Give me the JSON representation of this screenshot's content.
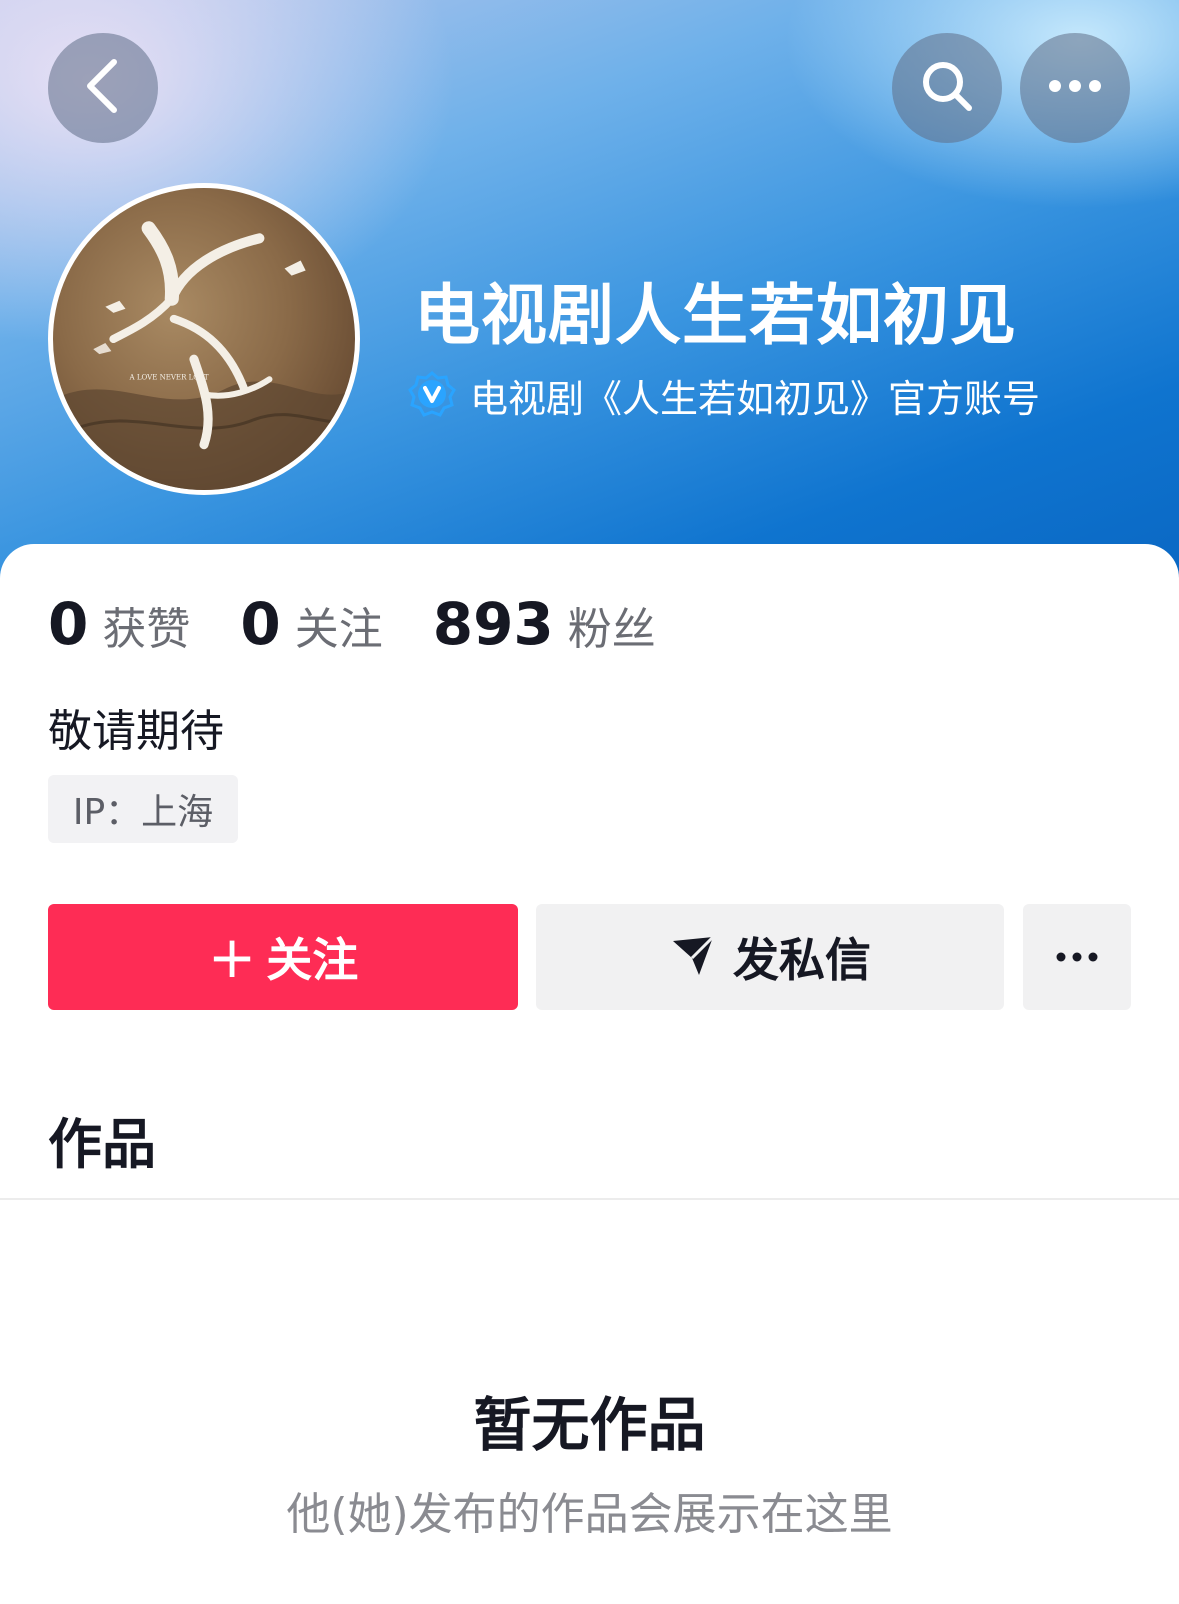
{
  "header": {
    "account_name": "电视剧人生若如初见",
    "verified_text": "电视剧《人生若如初见》官方账号",
    "back_icon": "chevron-left-icon",
    "search_icon": "search-icon",
    "more_icon": "more-dots-icon"
  },
  "avatar": {
    "logo_text": "A LOVE NEVER LOST"
  },
  "stats": [
    {
      "value": "0",
      "label": "获赞"
    },
    {
      "value": "0",
      "label": "关注"
    },
    {
      "value": "893",
      "label": "粉丝"
    }
  ],
  "bio": "敬请期待",
  "ip_location": "IP：上海",
  "actions": {
    "follow_plus": "+",
    "follow_label": "关注",
    "message_label": "发私信",
    "more_label": "···"
  },
  "works": {
    "title": "作品",
    "empty_title": "暂无作品",
    "empty_subtitle": "他(她)发布的作品会展示在这里"
  },
  "colors": {
    "accent": "#fe2c55",
    "header_blue": "#0f74cf",
    "verify_badge": "#2aa4ff"
  }
}
